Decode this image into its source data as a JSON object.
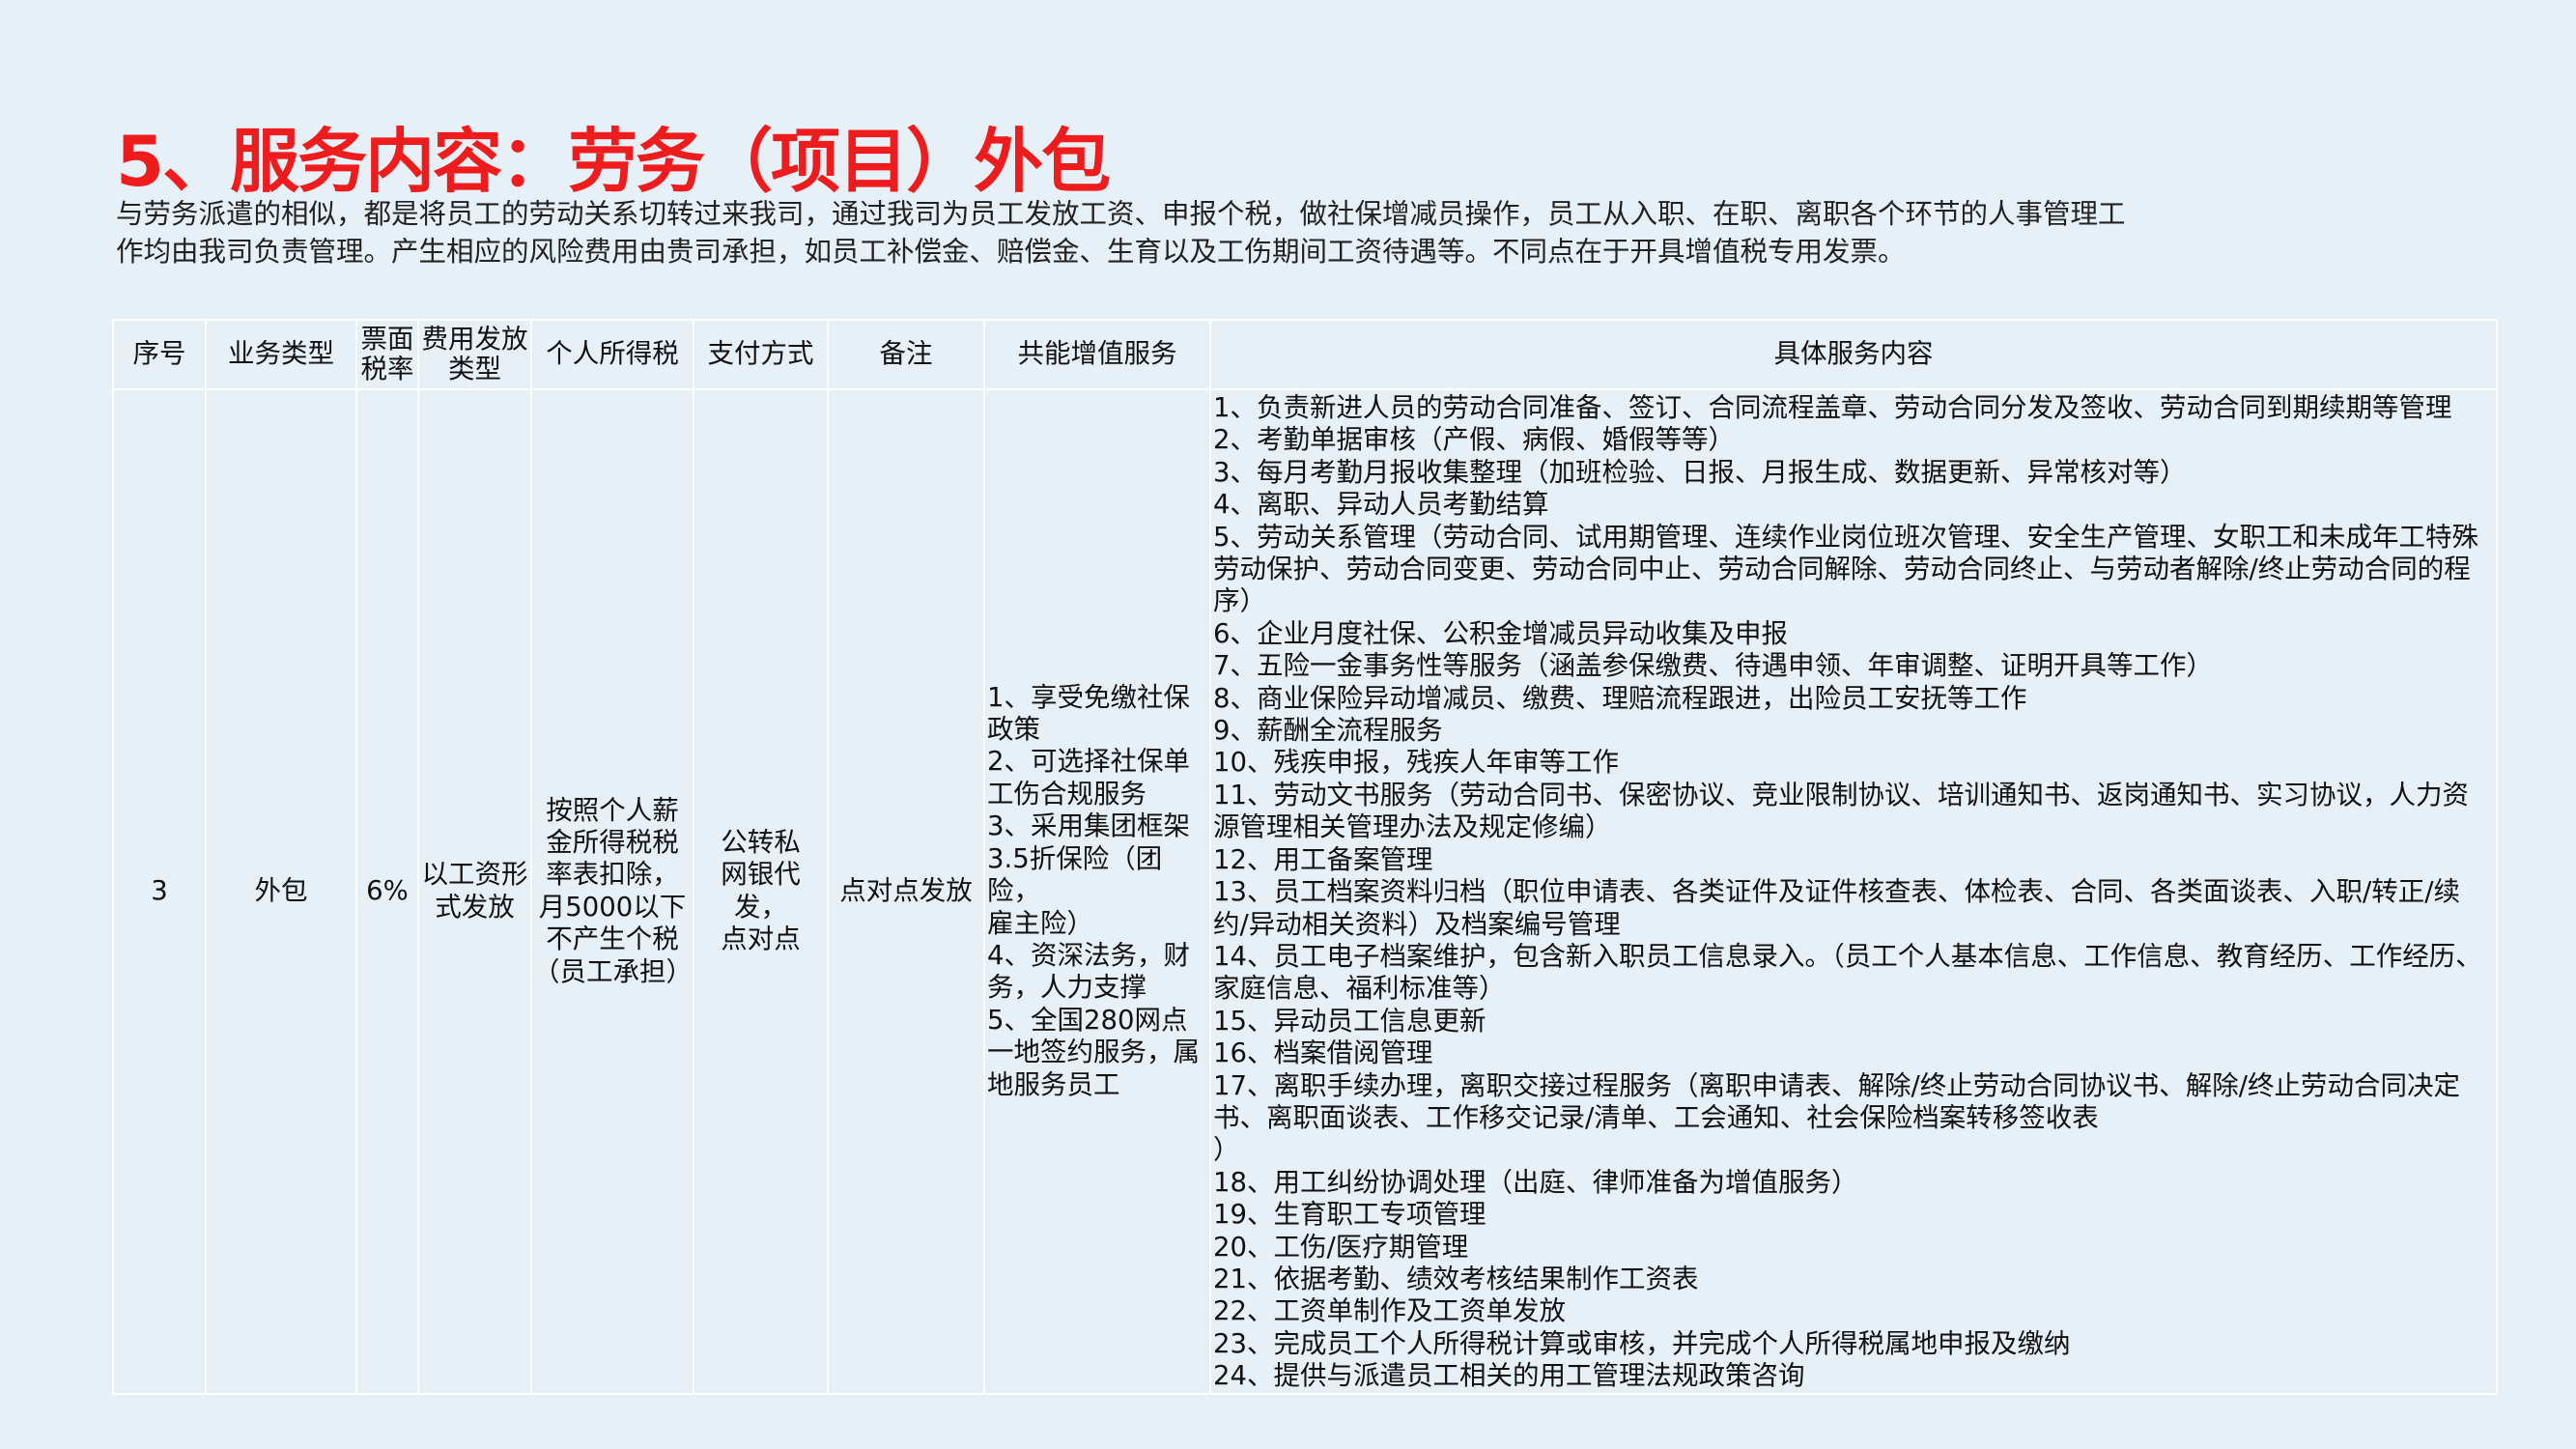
{
  "title": "5、服务内容：劳务（项目）外包",
  "intro": [
    "与劳务派遣的相似，都是将员工的劳动关系切转过来我司，通过我司为员工发放工资、申报个税，做社保增减员操作，员工从入职、在职、离职各个环节的人事管理工",
    "作均由我司负责管理。产生相应的风险费用由贵司承担，如员工补偿金、赔偿金、生育以及工伤期间工资待遇等。不同点在于开具增值税专用发票。"
  ],
  "table": {
    "headers": {
      "seq": "序号",
      "type": "业务类型",
      "rate": [
        "票面",
        "税率"
      ],
      "fee": [
        "费用发放",
        "类型"
      ],
      "tax": "个人所得税",
      "pay": "支付方式",
      "note": "备注",
      "vas": "共能增值服务",
      "detail": "具体服务内容"
    },
    "row": {
      "seq": "3",
      "type": "外包",
      "rate": "6%",
      "fee": [
        "以工资形",
        "式发放"
      ],
      "tax": [
        "按照个人薪",
        "金所得税税",
        "率表扣除，",
        "月5000以下",
        "不产生个税",
        "（员工承担）"
      ],
      "pay": [
        "公转私",
        "网银代发，",
        "点对点"
      ],
      "note": "点对点发放",
      "vas": [
        "1、享受免缴社保",
        "政策",
        "2、可选择社保单",
        "工伤合规服务",
        "3、采用集团框架",
        "3.5折保险（团险，",
        "雇主险）",
        "4、资深法务，财",
        "务，人力支撑",
        "5、全国280网点",
        "一地签约服务，属",
        "地服务员工"
      ],
      "detail": [
        "1、负责新进人员的劳动合同准备、签订、合同流程盖章、劳动合同分发及签收、劳动合同到期续期等管理",
        "2、考勤单据审核（产假、病假、婚假等等）",
        "3、每月考勤月报收集整理（加班检验、日报、月报生成、数据更新、异常核对等）",
        "4、离职、异动人员考勤结算",
        "5、劳动关系管理（劳动合同、试用期管理、连续作业岗位班次管理、安全生产管理、女职工和未成年工特殊",
        "劳动保护、劳动合同变更、劳动合同中止、劳动合同解除、劳动合同终止、与劳动者解除/终止劳动合同的程",
        "序）",
        "6、企业月度社保、公积金增减员异动收集及申报",
        "7、五险一金事务性等服务（涵盖参保缴费、待遇申领、年审调整、证明开具等工作）",
        "8、商业保险异动增减员、缴费、理赔流程跟进，出险员工安抚等工作",
        "9、薪酬全流程服务",
        "10、残疾申报，残疾人年审等工作",
        "11、劳动文书服务（劳动合同书、保密协议、竞业限制协议、培训通知书、返岗通知书、实习协议，人力资",
        "源管理相关管理办法及规定修编）",
        "12、用工备案管理",
        "13、员工档案资料归档（职位申请表、各类证件及证件核查表、体检表、合同、各类面谈表、入职/转正/续",
        "约/异动相关资料）及档案编号管理",
        "14、员工电子档案维护，包含新入职员工信息录入。（员工个人基本信息、工作信息、教育经历、工作经历、",
        "家庭信息、福利标准等）",
        "15、异动员工信息更新",
        "16、档案借阅管理",
        "17、离职手续办理，离职交接过程服务（离职申请表、解除/终止劳动合同协议书、解除/终止劳动合同决定",
        "书、离职面谈表、工作移交记录/清单、工会通知、社会保险档案转移签收表",
        "）",
        "18、用工纠纷协调处理（出庭、律师准备为增值服务）",
        "19、生育职工专项管理",
        "20、工伤/医疗期管理",
        "21、依据考勤、绩效考核结果制作工资表",
        "22、工资单制作及工资单发放",
        "23、完成员工个人所得税计算或审核，并完成个人所得税属地申报及缴纳",
        "24、提供与派遣员工相关的用工管理法规政策咨询"
      ]
    }
  }
}
